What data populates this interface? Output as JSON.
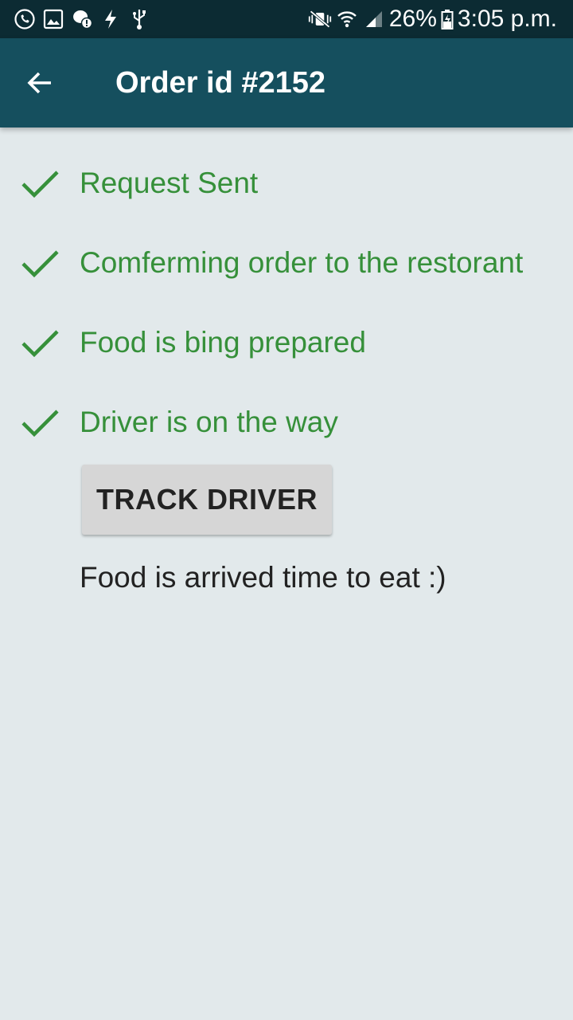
{
  "status_bar": {
    "battery": "26%",
    "time": "3:05 p.m.",
    "left_icons": [
      "whatsapp-icon",
      "image-icon",
      "alert-bubble-icon",
      "flash-icon",
      "usb-icon"
    ],
    "right_icons": [
      "mute-vibrate-icon",
      "wifi-icon",
      "signal-icon",
      "battery-icon"
    ]
  },
  "app_bar": {
    "back_icon": "arrow-back-icon",
    "title": "Order id #2152",
    "color": "#154f5e"
  },
  "steps": [
    {
      "label": "Request Sent",
      "done": true
    },
    {
      "label": "Comferming order to the restorant",
      "done": true
    },
    {
      "label": "Food is bing prepared",
      "done": true
    },
    {
      "label": "Driver is on the way",
      "done": true
    }
  ],
  "track_button": {
    "label": "TRACK DRIVER"
  },
  "arrived_text": "Food is arrived time to eat :)",
  "colors": {
    "accent_green": "#36903a",
    "background": "#e2e9eb",
    "status_bar": "#0c2b33"
  }
}
